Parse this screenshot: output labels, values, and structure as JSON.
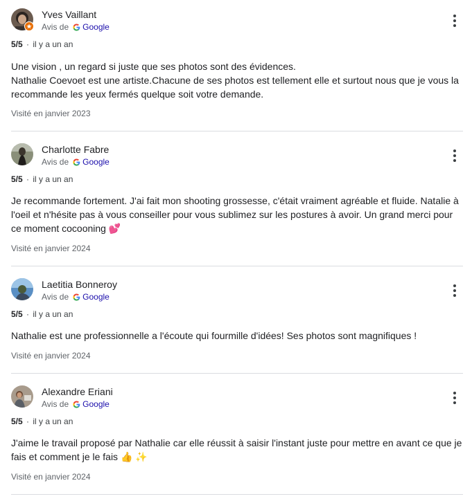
{
  "source_prefix": "Avis de",
  "source_name": "Google",
  "reviews": [
    {
      "author": "Yves Vaillant",
      "avatar": "avatar-photo",
      "local_guide_badge": true,
      "rating": "5/5",
      "time": "il y a un an",
      "text": "Une vision , un regard si juste que ses photos sont des évidences.\nNathalie Coevoet est une artiste.Chacune de ses photos est tellement elle et surtout nous que je vous la recommande les yeux fermés quelque soit votre demande.",
      "visited": "Visité en janvier 2023"
    },
    {
      "author": "Charlotte Fabre",
      "avatar": "avatar-photo",
      "local_guide_badge": false,
      "rating": "5/5",
      "time": "il y a un an",
      "text": "Je recommande fortement. J'ai fait mon shooting grossesse, c'était vraiment agréable et fluide. Natalie à l'oeil et n'hésite pas à vous conseiller pour vous sublimez sur les postures à avoir. Un grand merci pour ce moment cocooning 💕",
      "visited": "Visité en janvier 2024"
    },
    {
      "author": "Laetitia Bonneroy",
      "avatar": "avatar-photo",
      "local_guide_badge": false,
      "rating": "5/5",
      "time": "il y a un an",
      "text": "Nathalie est une professionnelle a l'écoute qui fourmille d'idées! Ses photos sont magnifiques !",
      "visited": "Visité en janvier 2024"
    },
    {
      "author": "Alexandre Eriani",
      "avatar": "avatar-photo",
      "local_guide_badge": false,
      "rating": "5/5",
      "time": "il y a un an",
      "text": "J'aime le travail proposé par Nathalie car elle réussit à saisir l'instant juste pour mettre en avant ce que je fais et comment je le fais 👍 ✨",
      "visited": "Visité en janvier 2024"
    }
  ],
  "colors": {
    "google_blue": "#4285f4",
    "google_red": "#ea4335",
    "google_yellow": "#fbbc05",
    "google_green": "#34a853",
    "link": "#1a0dab",
    "badge_orange": "#e8710a",
    "separator": "#dadce0"
  }
}
